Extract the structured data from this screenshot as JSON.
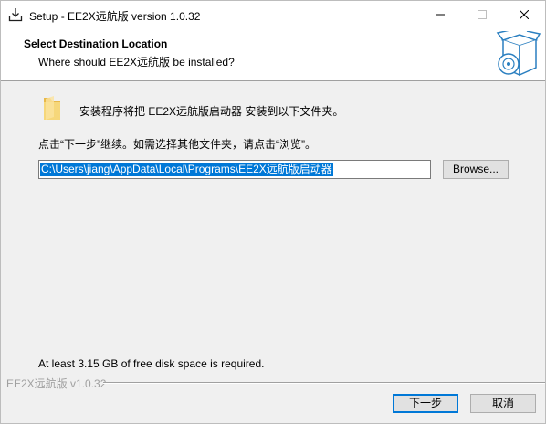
{
  "window": {
    "title": "Setup - EE2X远航版 version 1.0.32",
    "icons": {
      "app": "setup-icon",
      "minimize": "minimize-icon",
      "maximize": "maximize-icon",
      "close": "close-icon"
    }
  },
  "header": {
    "title": "Select Destination Location",
    "subtitle": "Where should EE2X远航版 be installed?",
    "image": "install-box-disc-icon"
  },
  "body": {
    "folder_icon": "folder-icon",
    "intro": "安装程序将把 EE2X远航版启动器 安装到以下文件夹。",
    "instructions": "点击“下一步”继续。如需选择其他文件夹，请点击“浏览”。",
    "path_value": "C:\\Users\\jiang\\AppData\\Local\\Programs\\EE2X远航版启动器",
    "browse_label": "Browse...",
    "disk_space": "At least 3.15 GB of free disk space is required."
  },
  "footer": {
    "brand": "EE2X远航版 v1.0.32",
    "next_label": "下一步",
    "cancel_label": "取消"
  },
  "colors": {
    "selection": "#0078d7",
    "default_button_border": "#0078d7",
    "brand_text": "#a0a0a0"
  }
}
